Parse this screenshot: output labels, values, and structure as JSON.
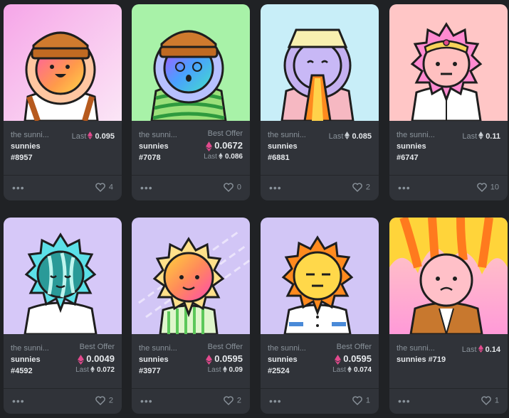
{
  "cards": [
    {
      "collection": "the sunni...",
      "name_line1": "sunnies",
      "name_line2": "#8957",
      "price_label": "Last",
      "price": "0.095",
      "last_label": "",
      "last_price": "",
      "likes": "4"
    },
    {
      "collection": "the sunni...",
      "name_line1": "sunnies",
      "name_line2": "#7078",
      "price_label": "Best Offer",
      "price": "0.0672",
      "last_label": "Last",
      "last_price": "0.086",
      "likes": "0"
    },
    {
      "collection": "the sunni...",
      "name_line1": "sunnies",
      "name_line2": "#6881",
      "price_label": "Last",
      "price": "0.085",
      "last_label": "",
      "last_price": "",
      "likes": "2"
    },
    {
      "collection": "the sunni...",
      "name_line1": "sunnies",
      "name_line2": "#6747",
      "price_label": "Last",
      "price": "0.11",
      "last_label": "",
      "last_price": "",
      "likes": "10"
    },
    {
      "collection": "the sunni...",
      "name_line1": "sunnies",
      "name_line2": "#4592",
      "price_label": "Best Offer",
      "price": "0.0049",
      "last_label": "Last",
      "last_price": "0.072",
      "likes": "2"
    },
    {
      "collection": "the sunni...",
      "name_line1": "sunnies",
      "name_line2": "#3977",
      "price_label": "Best Offer",
      "price": "0.0595",
      "last_label": "Last",
      "last_price": "0.09",
      "likes": "2"
    },
    {
      "collection": "the sunni...",
      "name_line1": "sunnies",
      "name_line2": "#2524",
      "price_label": "Best Offer",
      "price": "0.0595",
      "last_label": "Last",
      "last_price": "0.074",
      "likes": "1"
    },
    {
      "collection": "the sunni...",
      "name_line1": "sunnies #719",
      "name_line2": "",
      "price_label": "Last",
      "price": "0.14",
      "last_label": "",
      "last_price": "",
      "likes": "1"
    }
  ],
  "more_icon": "more-options-icon",
  "heart_icon": "heart-icon",
  "eth_icon": "ethereum-icon"
}
